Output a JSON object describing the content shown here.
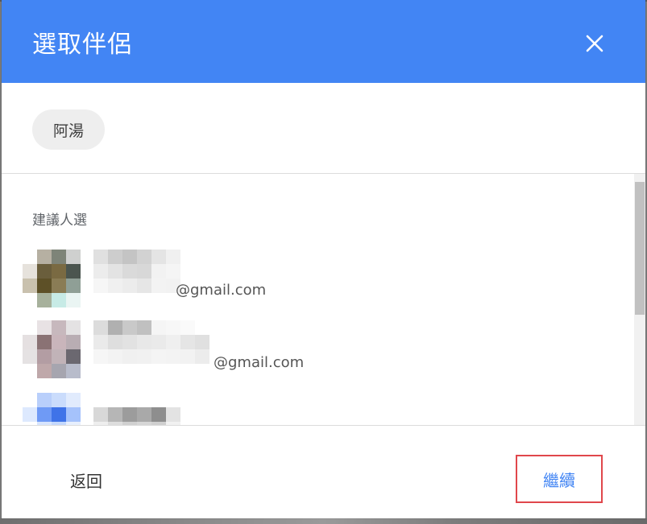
{
  "dialog": {
    "title": "選取伴侶",
    "close_icon": "close-icon",
    "selected_chip": "阿湯",
    "section_label": "建議人選",
    "contacts": [
      {
        "email_suffix": "@gmail.com"
      },
      {
        "email_suffix": "@gmail.com"
      },
      {
        "email_suffix": ""
      }
    ],
    "back_label": "返回",
    "continue_label": "繼續",
    "colors": {
      "header": "#4285f4",
      "accent": "#4285f4",
      "highlight_border": "#e0474c"
    }
  }
}
